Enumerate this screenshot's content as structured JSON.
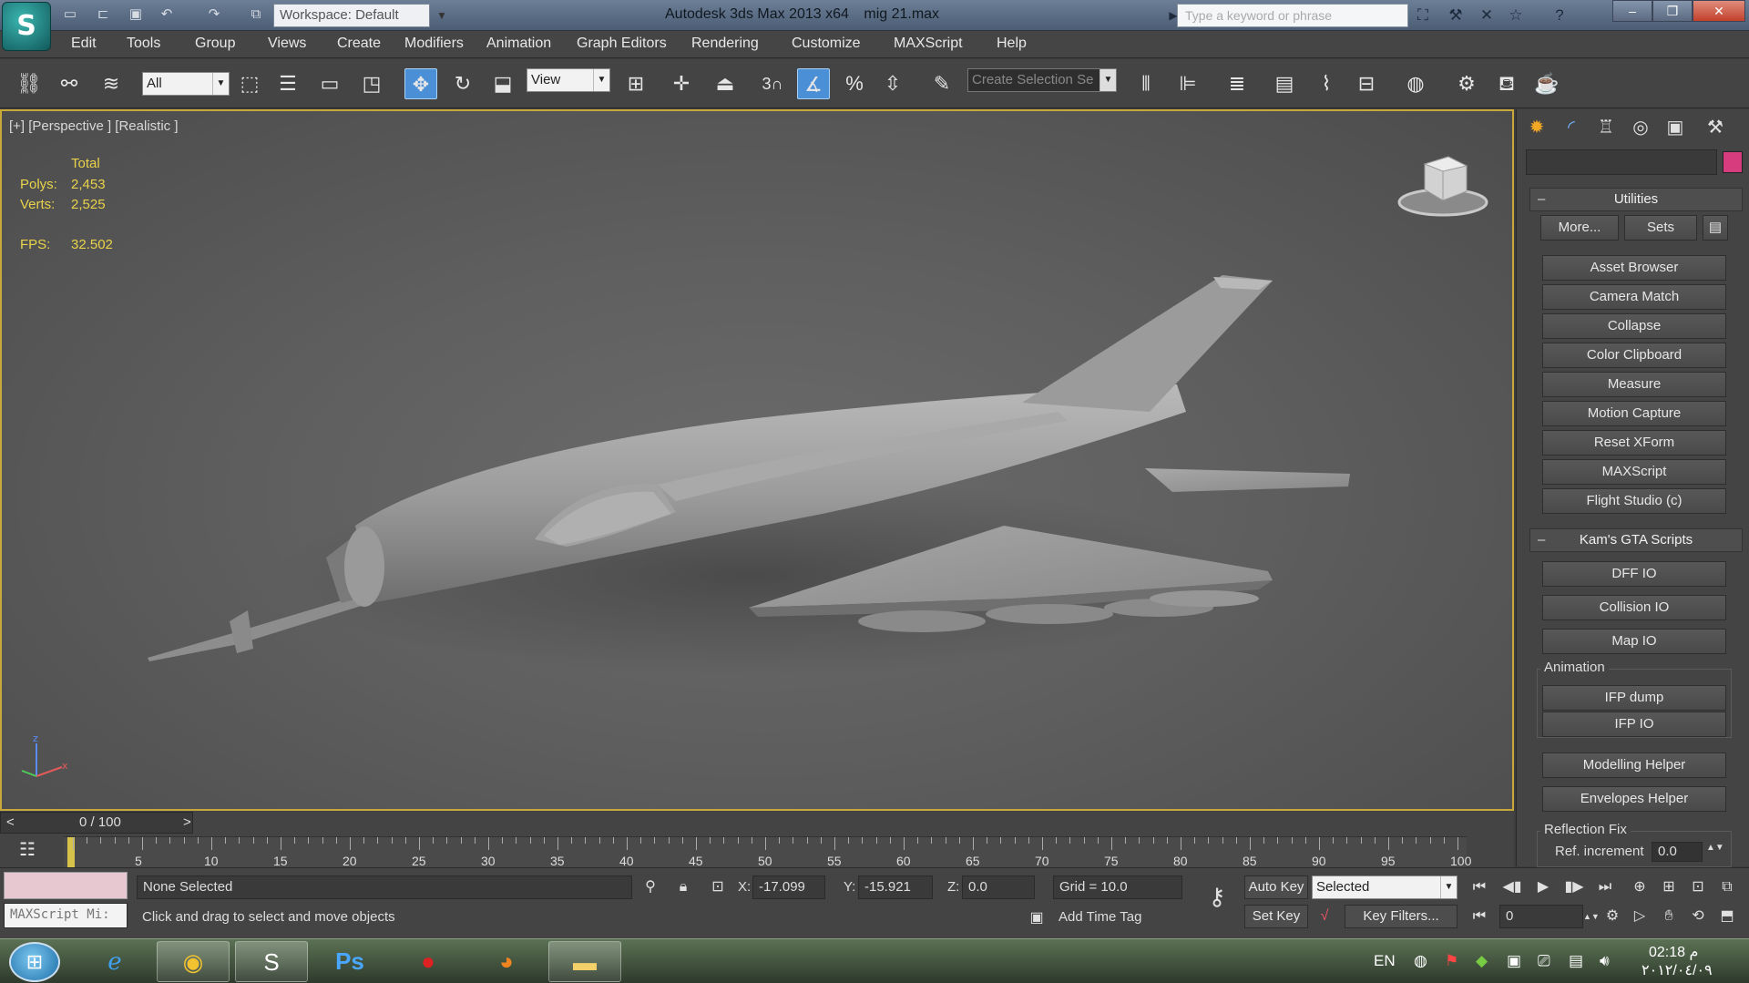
{
  "titlebar": {
    "workspace": "Workspace: Default",
    "app_title": "Autodesk 3ds Max  2013 x64",
    "file_name": "mig 21.max",
    "search_placeholder": "Type a keyword or phrase"
  },
  "menu": [
    "Edit",
    "Tools",
    "Group",
    "Views",
    "Create",
    "Modifiers",
    "Animation",
    "Graph Editors",
    "Rendering",
    "Customize",
    "MAXScript",
    "Help"
  ],
  "toolbar": {
    "selection_filter": "All",
    "ref_coord": "View",
    "snap_number": "3",
    "named_selection_placeholder": "Create Selection Se"
  },
  "viewport": {
    "label": "[+] [Perspective ] [Realistic ]",
    "stats": {
      "total_label": "Total",
      "polys_label": "Polys:",
      "polys_value": "2,453",
      "verts_label": "Verts:",
      "verts_value": "2,525",
      "fps_label": "FPS:",
      "fps_value": "32.502"
    },
    "axes": {
      "z": "z",
      "x": "x"
    }
  },
  "command_panel": {
    "utilities": {
      "title": "Utilities",
      "more": "More...",
      "sets": "Sets",
      "buttons": [
        "Asset Browser",
        "Camera Match",
        "Collapse",
        "Color Clipboard",
        "Measure",
        "Motion Capture",
        "Reset XForm",
        "MAXScript",
        "Flight Studio (c)"
      ]
    },
    "gta": {
      "title": "Kam's GTA Scripts",
      "buttons": [
        "DFF IO",
        "Collision IO",
        "Map IO"
      ],
      "animation_label": "Animation",
      "animation_buttons": [
        "IFP dump",
        "IFP IO"
      ],
      "helpers": [
        "Modelling Helper",
        "Envelopes Helper"
      ],
      "reflection_label": "Reflection Fix",
      "ref_increment_label": "Ref. increment",
      "ref_increment_value": "0.0"
    }
  },
  "timeline": {
    "slider_text": "0 / 100",
    "prev": "<",
    "next": ">",
    "ticks": [
      "5",
      "10",
      "15",
      "20",
      "25",
      "30",
      "35",
      "40",
      "45",
      "50",
      "55",
      "60",
      "65",
      "70",
      "75",
      "80",
      "85",
      "90",
      "95",
      "100"
    ]
  },
  "status": {
    "selection": "None Selected",
    "prompt": "Click and drag to select and move objects",
    "maxscript_listener": "MAXScript Mi:",
    "x_label": "X:",
    "x_value": "-17.099",
    "y_label": "Y:",
    "y_value": "-15.921",
    "z_label": "Z:",
    "z_value": "0.0",
    "grid": "Grid = 10.0",
    "add_time_tag": "Add Time Tag",
    "auto_key": "Auto Key",
    "set_key": "Set Key",
    "key_mode": "Selected",
    "key_filters": "Key Filters...",
    "frame_value": "0"
  },
  "taskbar": {
    "lang": "EN",
    "time": "02:18 م",
    "date": "٢٠١٢/٠٤/٠٩"
  }
}
